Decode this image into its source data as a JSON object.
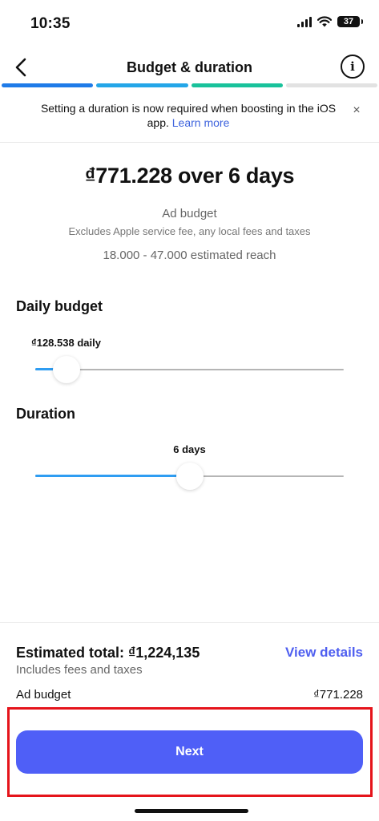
{
  "status_bar": {
    "time": "10:35",
    "battery": "37",
    "icons": [
      "signal-icon",
      "wifi-icon",
      "battery-icon"
    ]
  },
  "header": {
    "title": "Budget & duration",
    "back_icon": "chevron-left-icon",
    "info_icon": "info-icon",
    "info_glyph": "i"
  },
  "progress_steps": {
    "colors": [
      "#1f7be8",
      "#24a6e8",
      "#19c29b",
      "#e2e2e2"
    ],
    "completed": 3,
    "total": 4
  },
  "banner": {
    "text": "Setting a duration is now required when boosting in the iOS app.",
    "link": "Learn more",
    "close": "×"
  },
  "summary": {
    "headline": "₫771.228 over 6 days",
    "ad_budget_label": "Ad budget",
    "excludes_note": "Excludes Apple service fee, any local fees and taxes",
    "reach": "18.000 - 47.000 estimated reach"
  },
  "daily_budget": {
    "title": "Daily budget",
    "value_label": "₫128.538 daily",
    "fill_fraction": 0.1
  },
  "duration": {
    "title": "Duration",
    "value_label": "6 days",
    "fill_fraction": 0.5
  },
  "footer": {
    "estimated_total": "Estimated total: ₫1,224,135",
    "view_details": "View details",
    "includes_note": "Includes fees and taxes",
    "ad_budget_label": "Ad budget",
    "ad_budget_value": "₫771.228",
    "next_button": "Next"
  },
  "colors": {
    "accent": "#4f5ff7",
    "link": "#3e63dd",
    "slider_fill": "#2f9df2",
    "highlight": "#e5141b"
  }
}
